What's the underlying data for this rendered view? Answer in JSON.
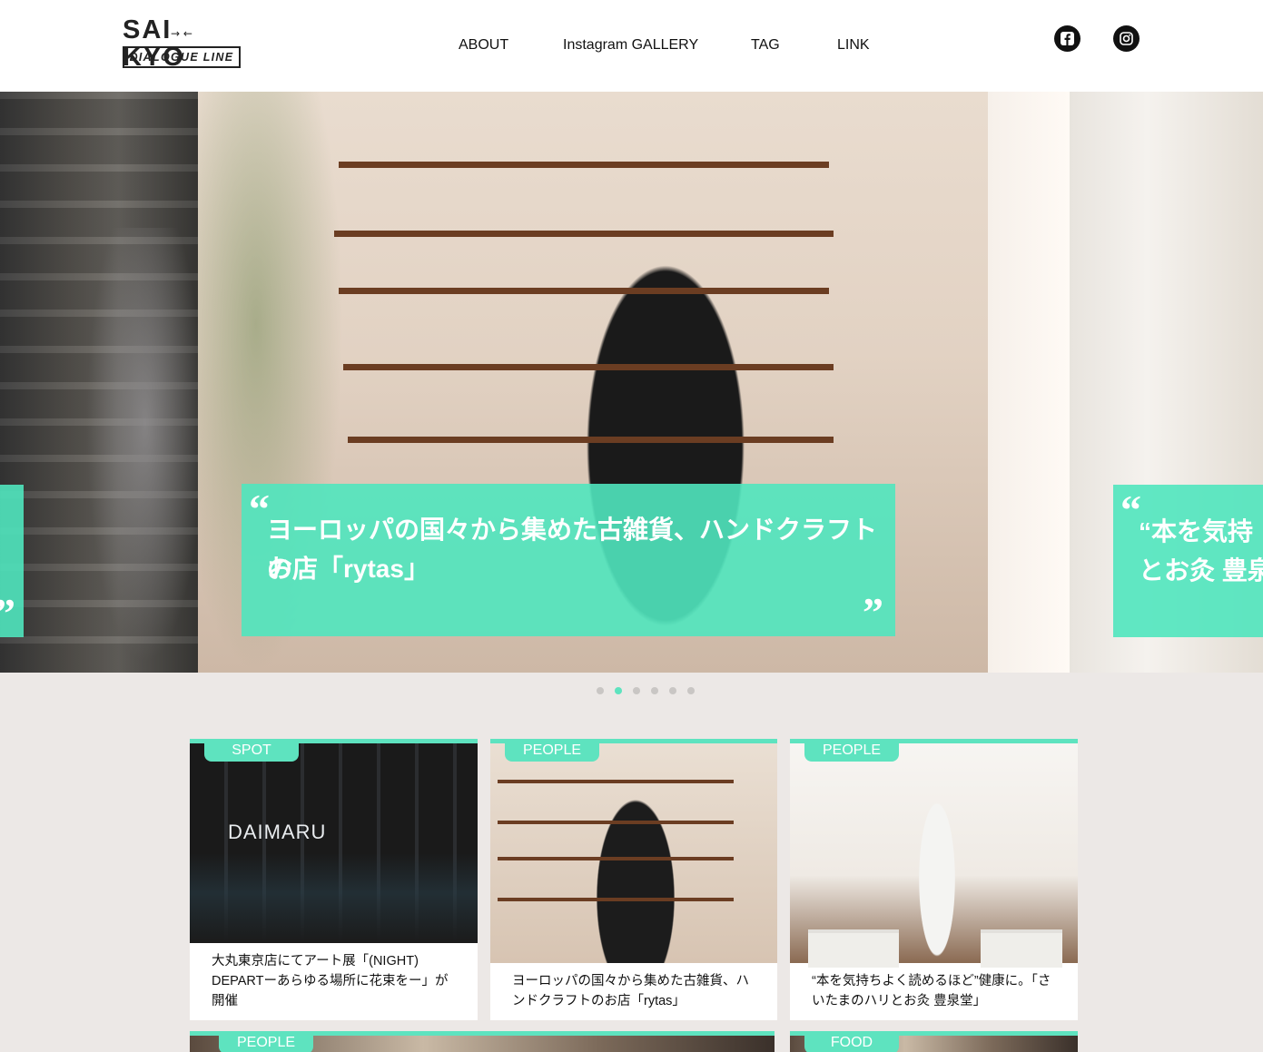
{
  "header": {
    "logo": {
      "top": "SAI KYO",
      "arrows": "→ ←",
      "bottom": "DIALOGUE LINE"
    },
    "nav": [
      "ABOUT",
      "Instagram GALLERY",
      "TAG",
      "LINK"
    ],
    "social": [
      {
        "name": "facebook",
        "icon": "facebook-icon"
      },
      {
        "name": "instagram",
        "icon": "instagram-icon"
      }
    ]
  },
  "hero": {
    "slides": [
      {
        "id": "prev",
        "quote_close": "”"
      },
      {
        "id": "current",
        "quote_open": "“",
        "quote_close": "”",
        "text_line1": "ヨーロッパの国々から集めた古雑貨、ハンドクラフトの",
        "text_line2": "お店「rytas」"
      },
      {
        "id": "next",
        "quote_open": "“",
        "text_line1": "“本を気持",
        "text_line2": "とお灸 豊泉"
      }
    ],
    "dots": {
      "count": 6,
      "active_index": 1
    },
    "accent_color": "#5ee3bf"
  },
  "cards": [
    {
      "tag": "SPOT",
      "image_label": "DAIMARU",
      "title": "大丸東京店にてアート展「(NIGHT) DEPARTーあらゆる場所に花束をー」が開催"
    },
    {
      "tag": "PEOPLE",
      "title": "ヨーロッパの国々から集めた古雑貨、ハンドクラフトのお店「rytas」"
    },
    {
      "tag": "PEOPLE",
      "title": "“本を気持ちよく読めるほど”健康に。「さいたまのハリとお灸 豊泉堂」"
    },
    {
      "tag": "PEOPLE",
      "title": ""
    },
    {
      "tag": "FOOD",
      "title": ""
    }
  ]
}
